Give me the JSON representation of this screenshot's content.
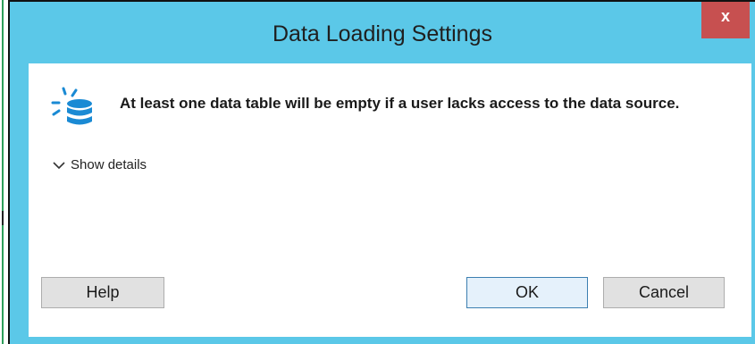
{
  "dialog": {
    "title": "Data Loading Settings",
    "close_label": "x",
    "message": "At least one data table will be empty if a user lacks access to the data source.",
    "details_toggle": "Show details",
    "buttons": {
      "help": "Help",
      "ok": "OK",
      "cancel": "Cancel"
    },
    "icons": {
      "message": "database-icon",
      "details": "chevron-down-icon",
      "close": "close-icon"
    },
    "colors": {
      "titlebar": "#5bc8e8",
      "close": "#c75050",
      "icon_blue": "#1a8ad4"
    }
  }
}
